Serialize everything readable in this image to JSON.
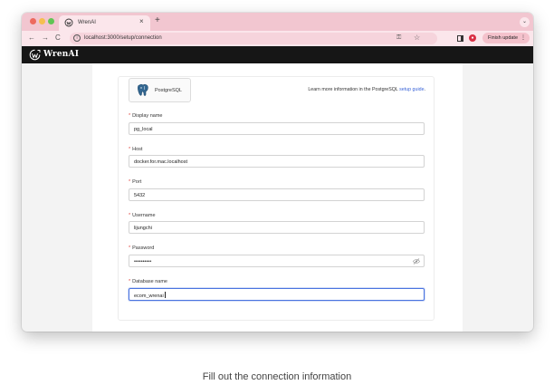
{
  "browser": {
    "tab_title": "WrenAI",
    "tab_close": "×",
    "new_tab": "+",
    "tab_menu": "⌄",
    "url": "localhost:3000/setup/connection",
    "finish_update": "Finish update",
    "back": "←",
    "forward": "→",
    "reload": "C",
    "more": "⋮"
  },
  "app": {
    "brand": "WrenAI"
  },
  "connection": {
    "datasource_label": "PostgreSQL",
    "learn_more_prefix": "Learn more information in the PostgreSQL ",
    "learn_more_link": "setup guide",
    "learn_more_suffix": ".",
    "required_mark": "*",
    "fields": [
      {
        "label": "Display name",
        "value": "pg_local"
      },
      {
        "label": "Host",
        "value": "docker.for.mac.localhost"
      },
      {
        "label": "Port",
        "value": "5432"
      },
      {
        "label": "Username",
        "value": "lijungchi"
      },
      {
        "label": "Password",
        "value": "••••••••••"
      },
      {
        "label": "Database name",
        "value": "ecom_wrenai"
      }
    ]
  },
  "caption": "Fill out the connection information",
  "colors": {
    "tab_strip": "#f2c6d0",
    "app_header": "#161616",
    "link": "#3a64d8",
    "required": "#e0443e",
    "focus": "#4a74e0"
  }
}
